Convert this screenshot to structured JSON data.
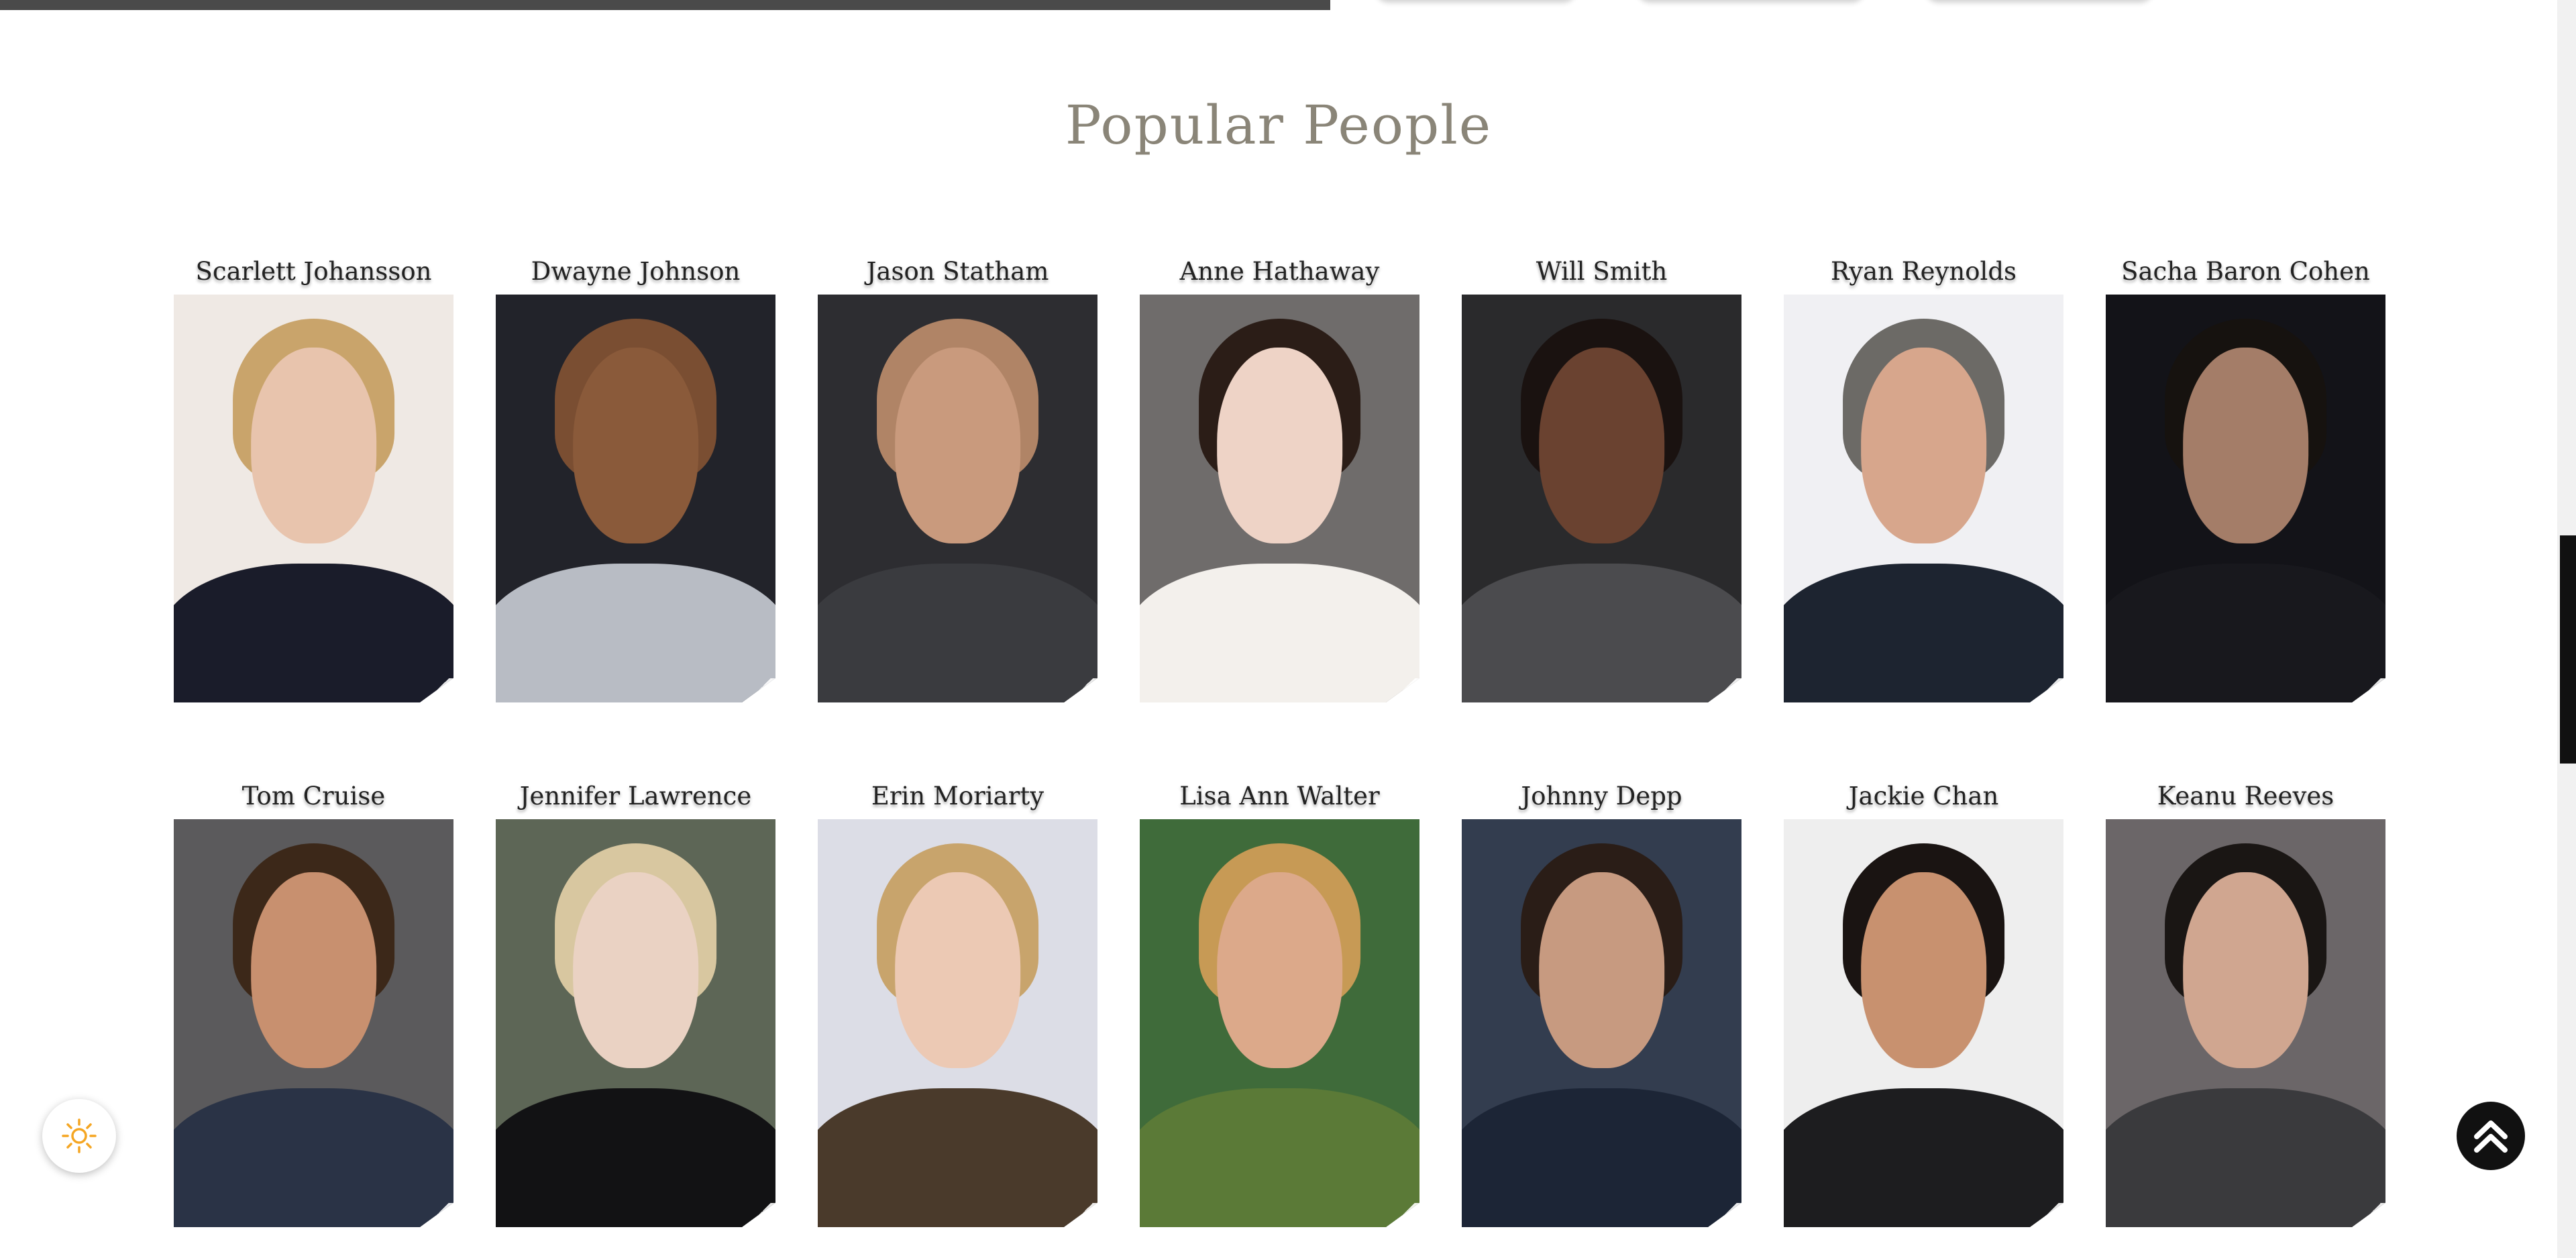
{
  "section": {
    "title": "Popular People"
  },
  "people": [
    {
      "name": "Scarlett Johansson",
      "bg": "#efe9e4",
      "skin": "#e8c4ad",
      "hair": "#c9a46b",
      "clothes": "#1a1c2a"
    },
    {
      "name": "Dwayne Johnson",
      "bg": "#22232a",
      "skin": "#8a5a3a",
      "hair": "#7a4e32",
      "clothes": "#b8bcc4"
    },
    {
      "name": "Jason Statham",
      "bg": "#2d2d31",
      "skin": "#c99a7d",
      "hair": "#b08466",
      "clothes": "#3a3b3f"
    },
    {
      "name": "Anne Hathaway",
      "bg": "#6f6c6b",
      "skin": "#eed3c6",
      "hair": "#2b1d17",
      "clothes": "#f3f0ec"
    },
    {
      "name": "Will Smith",
      "bg": "#2a2a2c",
      "skin": "#6a4230",
      "hair": "#1a1210",
      "clothes": "#4b4b4e"
    },
    {
      "name": "Ryan Reynolds",
      "bg": "#f0f0f3",
      "skin": "#d7a68c",
      "hair": "#6c6a66",
      "clothes": "#1d2430"
    },
    {
      "name": "Sacha Baron Cohen",
      "bg": "#131318",
      "skin": "#a47d68",
      "hair": "#16120f",
      "clothes": "#18181d"
    },
    {
      "name": "Tom Cruise",
      "bg": "#5b5a5c",
      "skin": "#c8906f",
      "hair": "#3c2819",
      "clothes": "#2a3346"
    },
    {
      "name": "Jennifer Lawrence",
      "bg": "#5d6656",
      "skin": "#ead2c3",
      "hair": "#d8c7a0",
      "clothes": "#121214"
    },
    {
      "name": "Erin Moriarty",
      "bg": "#dcdde6",
      "skin": "#ecc9b4",
      "hair": "#c8a46c",
      "clothes": "#4a3a2b"
    },
    {
      "name": "Lisa Ann Walter",
      "bg": "#3f6b3a",
      "skin": "#dca98a",
      "hair": "#c79a55",
      "clothes": "#5b7a37"
    },
    {
      "name": "Johnny Depp",
      "bg": "#333d4f",
      "skin": "#c79a80",
      "hair": "#2a1d17",
      "clothes": "#1c2536"
    },
    {
      "name": "Jackie Chan",
      "bg": "#eeeeee",
      "skin": "#c8916f",
      "hair": "#1a1412",
      "clothes": "#1d1d1f"
    },
    {
      "name": "Keanu Reeves",
      "bg": "#6b6668",
      "skin": "#d0a690",
      "hair": "#1a1614",
      "clothes": "#3a3a3d"
    }
  ],
  "controls": {
    "theme_toggle_icon": "sun-icon",
    "back_to_top_icon": "double-chevron-up-icon",
    "accent_color": "#f5a623"
  }
}
